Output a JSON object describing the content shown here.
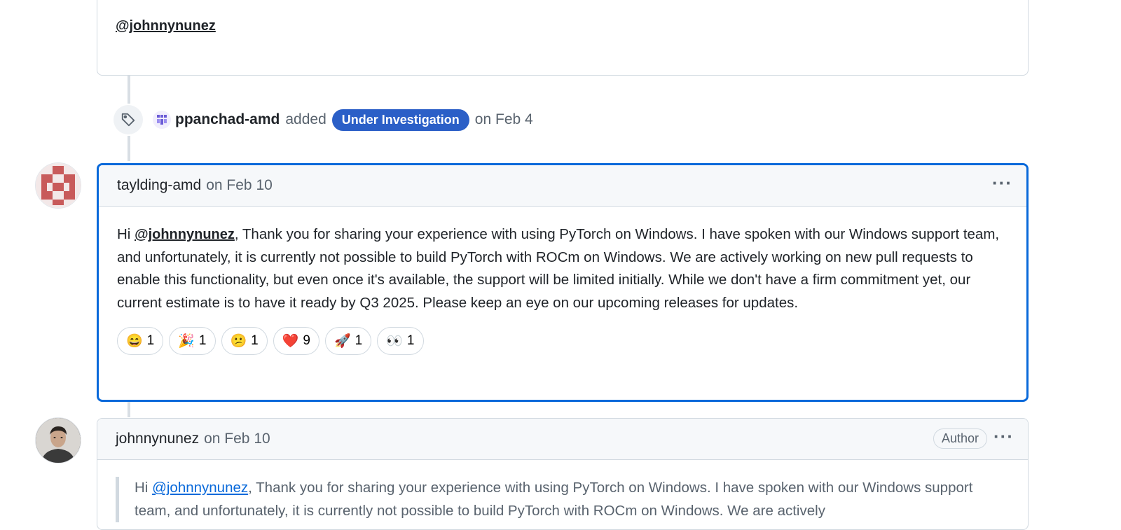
{
  "previous_comment": {
    "mention": "@johnnynunez"
  },
  "event": {
    "user": "ppanchad-amd",
    "action": "added",
    "label": "Under Investigation",
    "date_text": "on Feb 4",
    "label_color": "#2b5fc7",
    "icons": [
      "tag-icon",
      "user-avatar"
    ]
  },
  "comments": [
    {
      "author": "taylding-amd",
      "date": "on Feb 10",
      "body_prefix": "Hi ",
      "body_mention": "@johnnynunez",
      "body_rest": ", Thank you for sharing your experience with using PyTorch on Windows. I have spoken with our Windows support team, and unfortunately, it is currently not possible to build PyTorch with ROCm on Windows. We are actively working on new pull requests to enable this functionality, but even once it's available, the support will be limited initially. While we don't have a firm commitment yet, our current estimate is to have it ready by Q3 2025. Please keep an eye on our upcoming releases for updates.",
      "reactions": [
        {
          "emoji": "😄",
          "count": "1"
        },
        {
          "emoji": "🎉",
          "count": "1"
        },
        {
          "emoji": "😕",
          "count": "1"
        },
        {
          "emoji": "❤️",
          "count": "9"
        },
        {
          "emoji": "🚀",
          "count": "1"
        },
        {
          "emoji": "👀",
          "count": "1"
        }
      ]
    },
    {
      "author": "johnnynunez",
      "date": "on Feb 10",
      "badge": "Author",
      "quote_prefix": "Hi ",
      "quote_mention": "@johnnynunez",
      "quote_rest": ", Thank you for sharing your experience with using PyTorch on Windows. I have spoken with our Windows support team, and unfortunately, it is currently not possible to build PyTorch with ROCm on Windows. We are actively"
    }
  ],
  "colors": {
    "accent": "#0969da",
    "border": "#d1d9e0",
    "muted": "#59636e"
  }
}
